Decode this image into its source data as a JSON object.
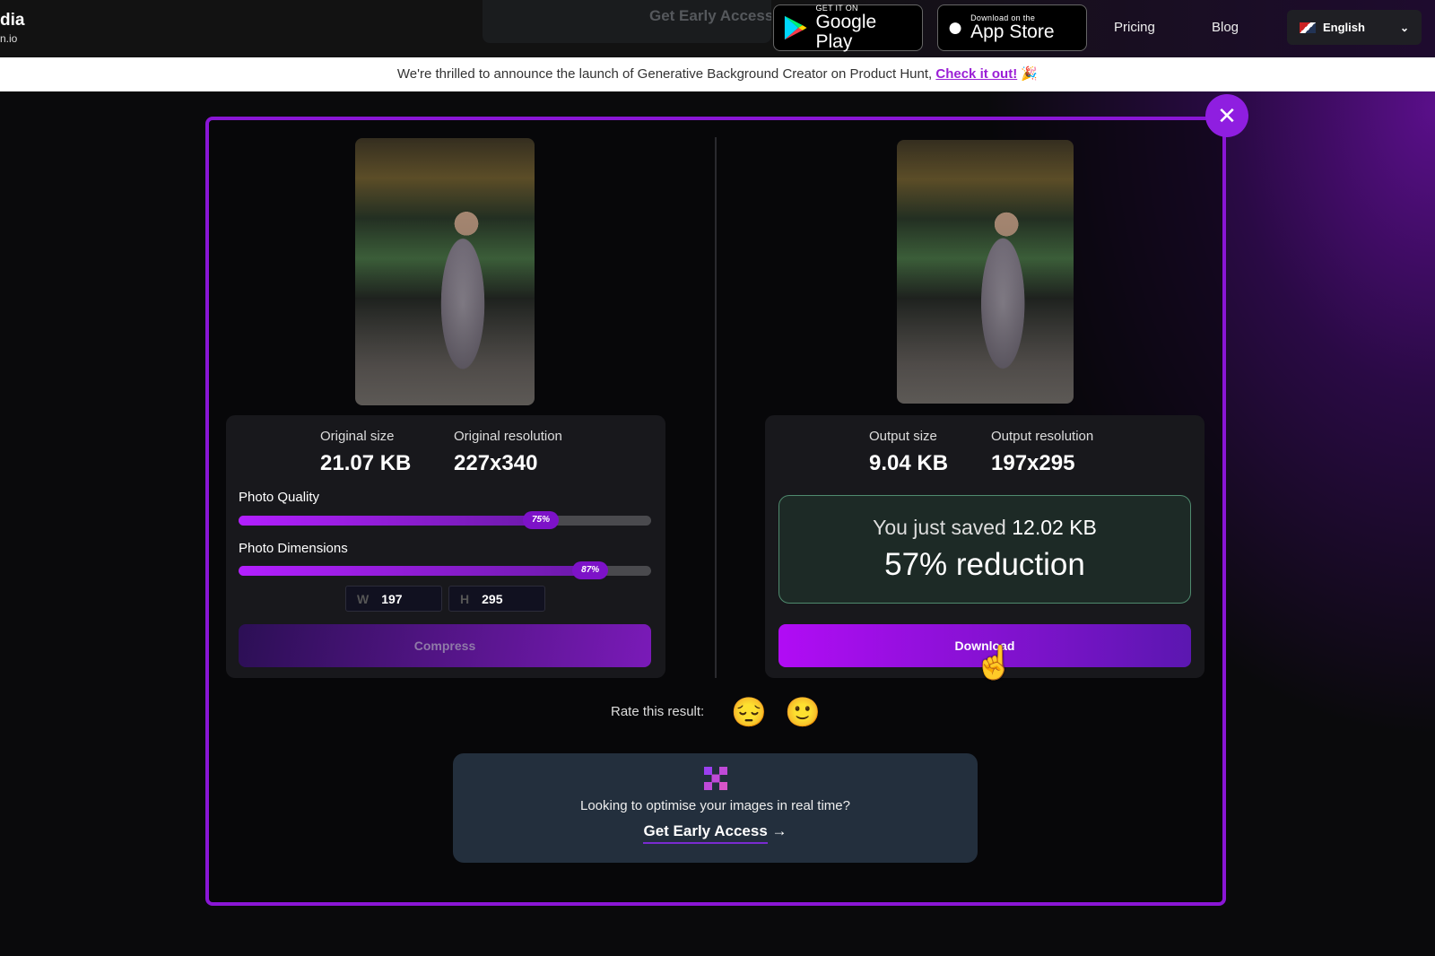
{
  "nav": {
    "logo_line1": "dia",
    "logo_line2": "n.io",
    "ghost_cta": "Get Early Access",
    "google_play": {
      "small": "GET IT ON",
      "big": "Google Play"
    },
    "app_store": {
      "small": "Download on the",
      "big": "App Store"
    },
    "pricing": "Pricing",
    "blog": "Blog",
    "language": "English"
  },
  "banner": {
    "text": "We're thrilled to announce the launch of Generative Background Creator on Product Hunt,",
    "link": "Check it out!",
    "emoji": "🎉"
  },
  "original": {
    "size_label": "Original size",
    "size": "21.07 KB",
    "res_label": "Original resolution",
    "res": "227x340",
    "quality_label": "Photo Quality",
    "quality_pct": 75,
    "quality_text": "75%",
    "dim_label": "Photo Dimensions",
    "dim_pct": 87,
    "dim_text": "87%",
    "w_label": "W",
    "w": "197",
    "h_label": "H",
    "h": "295",
    "compress": "Compress"
  },
  "output": {
    "size_label": "Output size",
    "size": "9.04 KB",
    "res_label": "Output resolution",
    "res": "197x295",
    "saved_prefix": "You just saved",
    "saved_value": "12.02 KB",
    "reduction": "57% reduction",
    "download": "Download"
  },
  "rate": {
    "label": "Rate this result:",
    "emoji1": "😔",
    "emoji2": "🙂"
  },
  "promo": {
    "text": "Looking to optimise your images in real time?",
    "cta": "Get Early Access",
    "arrow": "→"
  },
  "colors": {
    "accent": "#8a16d6",
    "success_border": "#4f8a6e"
  }
}
